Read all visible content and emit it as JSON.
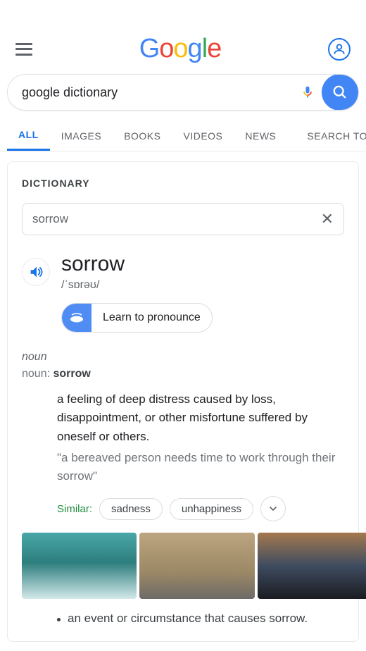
{
  "search": {
    "query": "google dictionary"
  },
  "tabs": {
    "all": "ALL",
    "images": "IMAGES",
    "books": "BOOKS",
    "videos": "VIDEOS",
    "news": "NEWS",
    "search_tools": "SEARCH TOOLS"
  },
  "dictionary": {
    "panel_title": "DICTIONARY",
    "lookup_value": "sorrow",
    "headword": "sorrow",
    "pronunciation": "/ˈsɒrəʊ/",
    "learn_label": "Learn to pronounce",
    "pos": "noun",
    "noun_line_prefix": "noun: ",
    "noun_line_word": "sorrow",
    "definition": "a feeling of deep distress caused by loss, disappointment, or other misfortune suffered by oneself or others.",
    "example": "\"a bereaved person needs time to work through their sorrow\"",
    "similar_label": "Similar:",
    "similar": {
      "0": "sadness",
      "1": "unhappiness"
    },
    "sub_definition": "an event or circumstance that causes sorrow."
  }
}
